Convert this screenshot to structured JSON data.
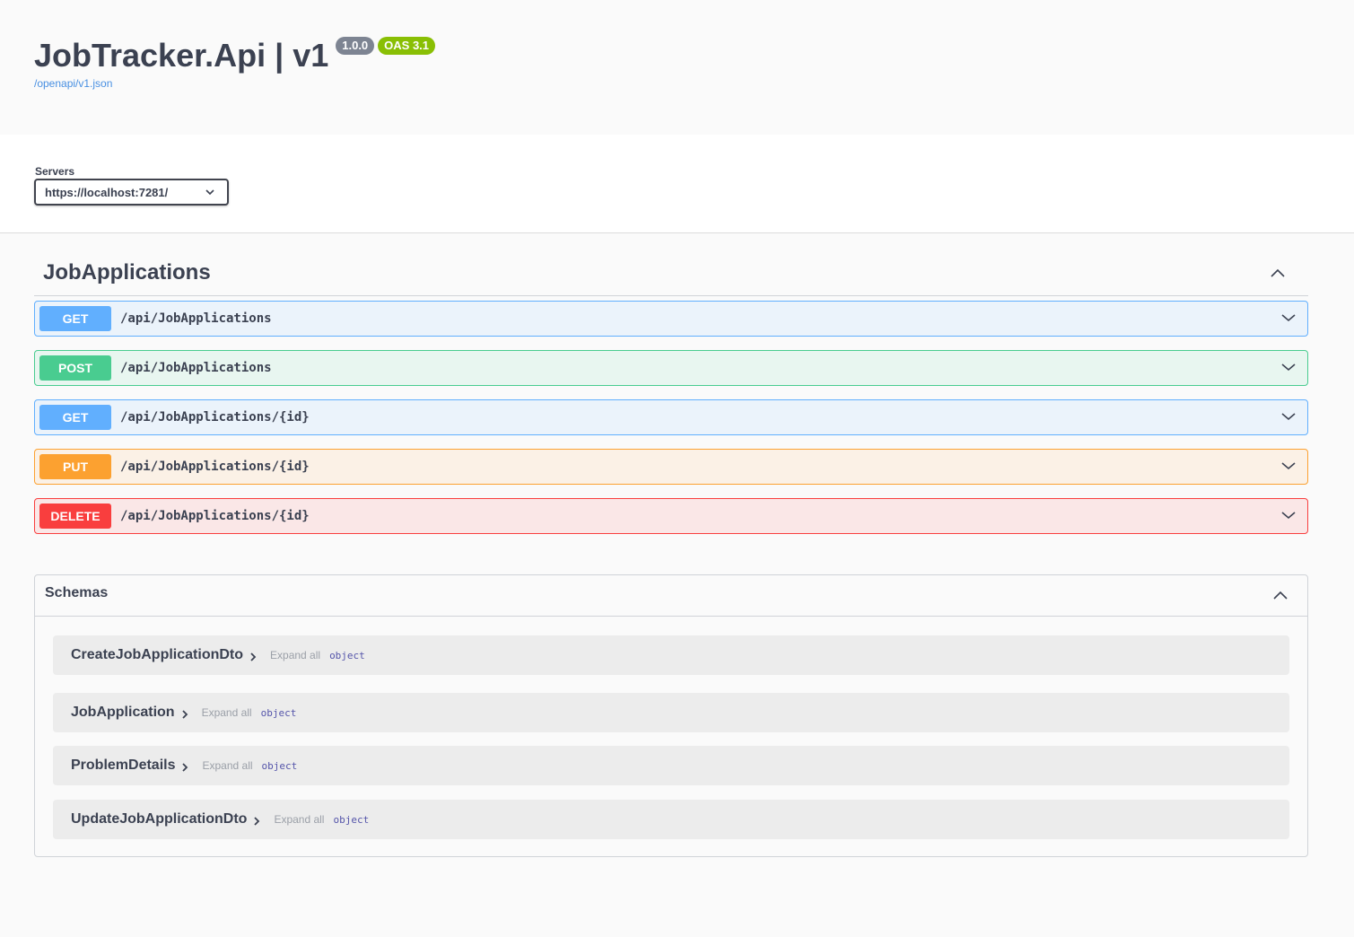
{
  "header": {
    "title": "JobTracker.Api | v1",
    "version_badge": "1.0.0",
    "oas_badge": "OAS 3.1",
    "spec_link": "/openapi/v1.json"
  },
  "servers": {
    "label": "Servers",
    "selected": "https://localhost:7281/"
  },
  "tag": {
    "name": "JobApplications",
    "operations": [
      {
        "method": "GET",
        "path": "/api/JobApplications"
      },
      {
        "method": "POST",
        "path": "/api/JobApplications"
      },
      {
        "method": "GET",
        "path": "/api/JobApplications/{id}"
      },
      {
        "method": "PUT",
        "path": "/api/JobApplications/{id}"
      },
      {
        "method": "DELETE",
        "path": "/api/JobApplications/{id}"
      }
    ]
  },
  "schemas": {
    "title": "Schemas",
    "models": [
      {
        "name": "CreateJobApplicationDto",
        "expand": "Expand all",
        "type": "object"
      },
      {
        "name": "JobApplication",
        "expand": "Expand all",
        "type": "object"
      },
      {
        "name": "ProblemDetails",
        "expand": "Expand all",
        "type": "object"
      },
      {
        "name": "UpdateJobApplicationDto",
        "expand": "Expand all",
        "type": "object"
      }
    ]
  },
  "icons": {
    "chevron_down": "chevron-down-icon",
    "chevron_up": "chevron-up-icon",
    "chevron_right": "chevron-right-icon"
  },
  "colors": {
    "get": "#61affe",
    "post": "#49cc90",
    "put": "#fca130",
    "delete": "#f93e3e",
    "version_badge": "#7d8492",
    "oas_badge": "#89bf04"
  }
}
